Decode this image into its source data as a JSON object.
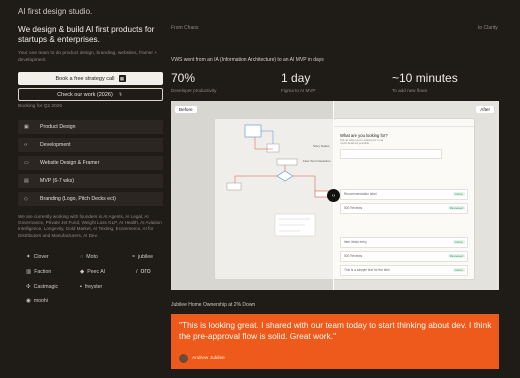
{
  "studio_name": "AI first design studio.",
  "hero": {
    "headline": "We design & build AI first products for startups & enterprises.",
    "subtext": "Your one team to do product design, branding, websites, framer + development."
  },
  "cta": {
    "primary_label": "Book a free strategy call",
    "secondary_label": "Check our work (2026)",
    "booking_note": "Booking for Q2 2026"
  },
  "services": [
    {
      "icon": "box-icon",
      "glyph": "▣",
      "label": "Product Design"
    },
    {
      "icon": "code-icon",
      "glyph": "‹›",
      "label": "Development"
    },
    {
      "icon": "monitor-icon",
      "glyph": "▭",
      "label": "Website Design & Framer"
    },
    {
      "icon": "chart-icon",
      "glyph": "▤",
      "label": "MVP (6-7 wks)"
    },
    {
      "icon": "tag-icon",
      "glyph": "◇",
      "label": "Branding (Logo, Pitch Decks ect)"
    }
  ],
  "partners_text": "We are currently working with founders in AI Agents, AI Legal, AI Governance, Private Jet Fund, Weight Loss GLP, AI Health, AI Aviation Intelligence, Longevity, Gold Market, AI Texting, Ecommerce, AI for Distributors and Manufacturers, AI Dev.",
  "logos": [
    {
      "name": "Clover",
      "glyph": "✦"
    },
    {
      "name": "Moto",
      "glyph": "◌"
    },
    {
      "name": "jubilee",
      "glyph": "≈"
    },
    {
      "name": "Faction",
      "glyph": "▥"
    },
    {
      "name": "Peec AI",
      "glyph": "◆"
    },
    {
      "name": "oro",
      "glyph": "/"
    },
    {
      "name": "Castmagic",
      "glyph": "✣"
    },
    {
      "name": "freyster",
      "glyph": "▪"
    },
    {
      "name": "",
      "glyph": ""
    },
    {
      "name": "moohi",
      "glyph": "◉"
    }
  ],
  "case": {
    "from_label": "From Chaos",
    "to_label": "to Clarity",
    "description": "VWS went from an IA (Information Architecture) to an AI MVP in days",
    "stats": [
      {
        "value": "70%",
        "label": "Developer productivity"
      },
      {
        "value": "1 day",
        "label": "Figma to AI MVP"
      },
      {
        "value": "~10 minutes",
        "label": "To add new flows"
      }
    ],
    "before_label": "Before",
    "after_label": "After",
    "mock": {
      "question": "What are you looking for?",
      "desc_line": "Tell us what you're looking for in as much detail as possible.",
      "story_label": "Story Nodes",
      "flow_label": "Flow Text Interaction",
      "rows": [
        {
          "text": "Recommendation label",
          "chip": "Active",
          "chip_color": "#2f9e5b"
        },
        {
          "text": "500 Reviews",
          "chip": "Reviewed",
          "chip_color": "#2f9e5b"
        },
        {
          "text": "Item detail entry",
          "chip": "Active",
          "chip_color": "#2f9e5b"
        },
        {
          "text": "500 Reviews",
          "chip": "Reviewed",
          "chip_color": "#2f9e5b"
        },
        {
          "text": "This is a sample text for the item",
          "chip": "Active",
          "chip_color": "#2f9e5b"
        }
      ]
    }
  },
  "testimonial": {
    "caption": "Jubilee Home Ownership at 2% Down",
    "quote": "\"This is looking great. I shared with our team today to start thinking about dev. I think the pre-approval flow is solid. Great work.\"",
    "author": "Andrew Jubilee",
    "bg_color": "#ee5a1c"
  }
}
